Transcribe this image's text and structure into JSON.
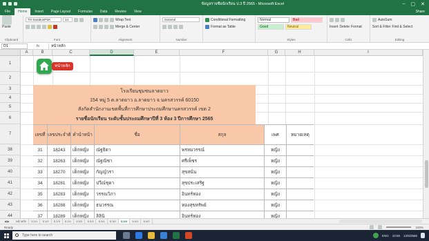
{
  "window": {
    "title": "ข้อมูลรายชื่อนักเรียน ป.3 ปี 2565 - Microsoft Excel",
    "controls": [
      "–",
      "▢",
      "✕"
    ]
  },
  "ribbon_tabs": [
    "File",
    "Home",
    "Insert",
    "Page Layout",
    "Formulas",
    "Data",
    "Review",
    "View"
  ],
  "share_label": "Share",
  "ribbon": {
    "clipboard_label": "Clipboard",
    "paste_label": "Paste",
    "font_label": "Font",
    "font_name": "TH SarabunPSK",
    "font_size": "14",
    "alignment_label": "Alignment",
    "wrap_text": "Wrap Text",
    "merge_center": "Merge & Center",
    "number_label": "Number",
    "number_format": "General",
    "conditional_formatting": "Conditional Formatting",
    "format_as_table": "Format as Table",
    "styles_label": "Styles",
    "style_normal": "Normal",
    "style_bad": "Bad",
    "style_good": "Good",
    "style_neutral": "Neutral",
    "cells_label": "Cells",
    "insert": "Insert",
    "delete": "Delete",
    "format": "Format",
    "editing_label": "Editing",
    "autosum": "AutoSum",
    "sort_filter": "Sort & Filter",
    "find_select": "Find & Select"
  },
  "formula_bar": {
    "name_box": "D1",
    "fx": "fx",
    "value": "หน้าหลัก"
  },
  "columns": [
    "A",
    "B",
    "C",
    "D",
    "E",
    "F",
    "G",
    "H",
    "I"
  ],
  "selected_column": "D",
  "rows": [
    "1",
    "2",
    "3",
    "4",
    "5",
    "6",
    "7",
    "38",
    "39",
    "40",
    "41",
    "42",
    "43",
    "44"
  ],
  "home_button_label": "หน้าหลัก",
  "sheet_header": {
    "line1": "โรงเรียนชุมชนลาดยาว",
    "line2": "154 หมู่ 5 ต.ลาดยาว อ.ลาดยาว จ.นครสวรรค์ 60150",
    "line3": "สังกัดสำนักงานเขตพื้นที่การศึกษาประถมศึกษานครสวรรค์ เขต 2",
    "line4": "รายชื่อนักเรียน ระดับชั้นประถมศึกษาปีที่ 3 ห้อง 3  ปีการศึกษา  2565"
  },
  "table": {
    "headers": [
      "เลขที่",
      "เลขประจำตัวนักเรียน",
      "คำนำหน้า",
      "ชื่อ",
      "สกุล",
      "เพศ",
      "หมายเหตุ"
    ],
    "rows": [
      [
        "31",
        "18243",
        "เด็กหญิง",
        "ณัฐธิดา",
        "พรหมวรรณ์",
        "หญิง",
        ""
      ],
      [
        "32",
        "18263",
        "เด็กหญิง",
        "ณัฐณิชา",
        "ศรีเพ็ชร",
        "หญิง",
        ""
      ],
      [
        "33",
        "18270",
        "เด็กหญิง",
        "กัญญ์วรา",
        "สุขสนั่น",
        "หญิง",
        ""
      ],
      [
        "34",
        "18281",
        "เด็กหญิง",
        "ปวีณ์ชุดา",
        "สุขประเสริฐ",
        "หญิง",
        ""
      ],
      [
        "35",
        "18283",
        "เด็กหญิง",
        "วรรณวิภา",
        "อินทร์ทอง",
        "หญิง",
        ""
      ],
      [
        "36",
        "18288",
        "เด็กหญิง",
        "ธนวรรณ",
        "ทองสุขทรัพย์",
        "หญิง",
        ""
      ],
      [
        "37",
        "18289",
        "เด็กหญิง",
        "ลิลินิ",
        "อินทร์ทอง",
        "หญิง",
        ""
      ]
    ]
  },
  "sheet_tabs": [
    "หน้าหลัก",
    "ป.1/1",
    "ป.1/2",
    "ป.1/3",
    "ป.2/1",
    "ป.2/2",
    "ป.2/3",
    "ป.3/1",
    "ป.3/2",
    "ป.3/3",
    "ป.4/1",
    "ป.4/2"
  ],
  "active_sheet": "ป.3/3",
  "status": {
    "ready": "Ready",
    "zoom": "100%"
  },
  "taskbar": {
    "search_placeholder": "Type here to search",
    "tray_text": "ENG",
    "time": "10:55",
    "date": "12/5/2565"
  },
  "colors": {
    "excel_green": "#217346",
    "header_fill": "#f9c8a8",
    "home_button": "#2fa84f",
    "home_label_bg": "#d9342b"
  }
}
